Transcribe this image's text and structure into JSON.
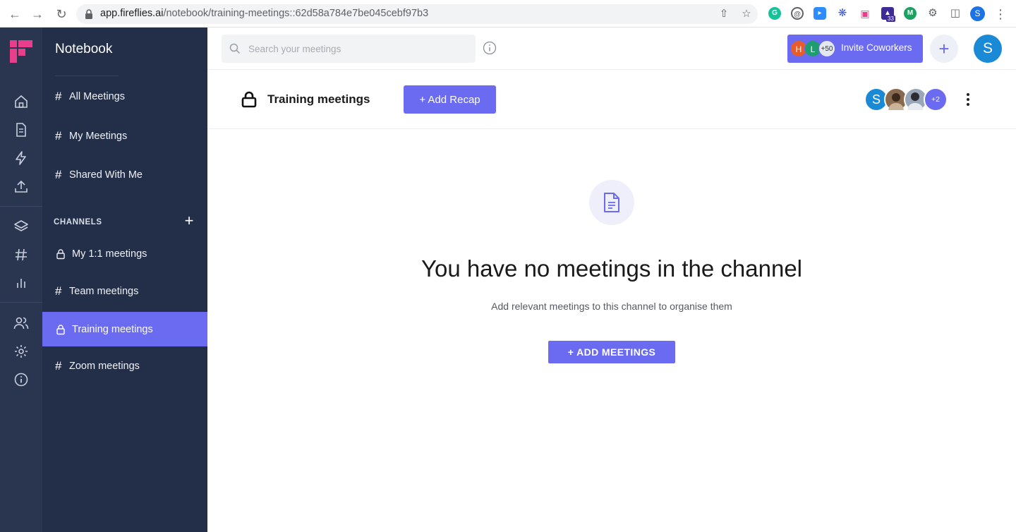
{
  "browser": {
    "url_host": "app.fireflies.ai",
    "url_path": "/notebook/training-meetings::62d58a784e7be045cebf97b3",
    "extension_badge": "33",
    "profile_initial": "S"
  },
  "sidebar": {
    "title": "Notebook",
    "nav_items": [
      {
        "label": "All Meetings"
      },
      {
        "label": "My Meetings"
      },
      {
        "label": "Shared With Me"
      }
    ],
    "channels_label": "CHANNELS",
    "channels": [
      {
        "label": "My 1:1 meetings",
        "type": "private"
      },
      {
        "label": "Team meetings",
        "type": "public"
      },
      {
        "label": "Training meetings",
        "type": "private",
        "active": true
      },
      {
        "label": "Zoom meetings",
        "type": "public"
      }
    ]
  },
  "topbar": {
    "search_placeholder": "Search your meetings",
    "invite_avatars": [
      {
        "initial": "H",
        "color": "#e85b2a"
      },
      {
        "initial": "L",
        "color": "#1e9e6e"
      }
    ],
    "invite_count": "+50",
    "invite_label": "Invite Coworkers",
    "add_symbol": "+",
    "user_initial": "S"
  },
  "channel": {
    "title": "Training meetings",
    "add_recap_label": "+  Add Recap",
    "member_initial": "S",
    "members_more": "+2"
  },
  "empty_state": {
    "title": "You have no meetings in the channel",
    "subtitle": "Add relevant meetings to this channel to organise them",
    "button_label": "+  ADD MEETINGS"
  },
  "colors": {
    "accent": "#6b6bf2",
    "sidebar_bg": "#232f48",
    "rail_bg": "#2a3550"
  }
}
